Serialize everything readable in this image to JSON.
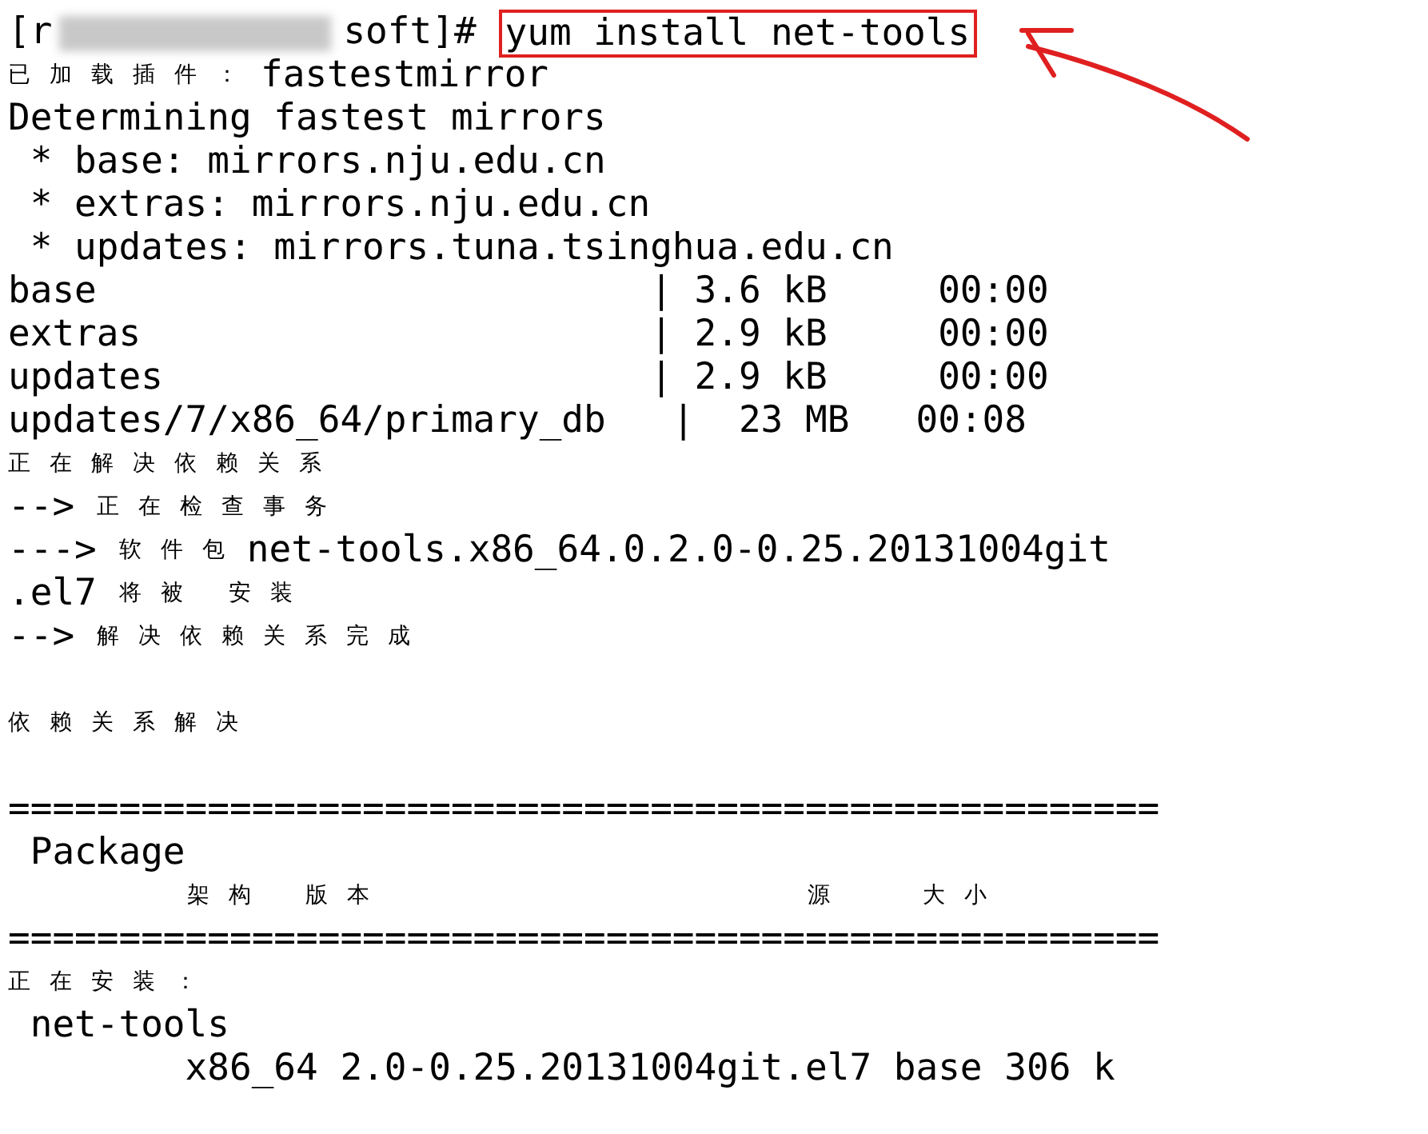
{
  "prompt": {
    "user_start": "[r",
    "redacted": true,
    "path": "soft]#",
    "command": "yum install net-tools",
    "highlighted": true,
    "arrow": true
  },
  "lines": [
    {
      "segs": [
        {
          "kind": "cjk",
          "text": "已加载插件："
        },
        {
          "kind": "mono",
          "text": "fastestmirror"
        }
      ]
    },
    {
      "segs": [
        {
          "kind": "mono",
          "text": "Determining fastest mirrors"
        }
      ]
    },
    {
      "segs": [
        {
          "kind": "mono",
          "text": " * base: mirrors.nju.edu.cn"
        }
      ]
    },
    {
      "segs": [
        {
          "kind": "mono",
          "text": " * extras: mirrors.nju.edu.cn"
        }
      ]
    },
    {
      "segs": [
        {
          "kind": "mono",
          "text": " * updates: mirrors.tuna.tsinghua.edu.cn"
        }
      ]
    },
    {
      "segs": [
        {
          "kind": "mono",
          "text": "base                         | 3.6 kB     00:00"
        }
      ]
    },
    {
      "segs": [
        {
          "kind": "mono",
          "text": "extras                       | 2.9 kB     00:00"
        }
      ]
    },
    {
      "segs": [
        {
          "kind": "mono",
          "text": "updates                      | 2.9 kB     00:00"
        }
      ]
    },
    {
      "segs": [
        {
          "kind": "mono",
          "text": "updates/7/x86_64/primary_db   |  23 MB   00:08"
        }
      ]
    },
    {
      "segs": [
        {
          "kind": "cjk",
          "text": "正在解决依赖关系"
        }
      ]
    },
    {
      "segs": [
        {
          "kind": "mono",
          "text": "-->"
        },
        {
          "kind": "cjk",
          "text": "正在检查事务"
        }
      ]
    },
    {
      "segs": [
        {
          "kind": "mono",
          "text": "--->"
        },
        {
          "kind": "cjk",
          "text": "软件包"
        },
        {
          "kind": "mono",
          "text": "net-tools.x86_64.0.2.0-0.25.20131004git"
        }
      ]
    },
    {
      "segs": [
        {
          "kind": "mono",
          "text": ".el7"
        },
        {
          "kind": "cjk",
          "text": "将被 安装"
        }
      ]
    },
    {
      "segs": [
        {
          "kind": "mono",
          "text": "-->"
        },
        {
          "kind": "cjk",
          "text": "解决依赖关系完成"
        }
      ]
    },
    {
      "kind": "blank"
    },
    {
      "segs": [
        {
          "kind": "cjk",
          "text": "依赖关系解决"
        }
      ]
    },
    {
      "kind": "blank"
    },
    {
      "segs": [
        {
          "kind": "mono",
          "text": "===================================================="
        }
      ]
    },
    {
      "segs": [
        {
          "kind": "mono",
          "text": " Package"
        }
      ]
    },
    {
      "segs": [
        {
          "kind": "arch",
          "text": "架构"
        },
        {
          "kind": "version",
          "text": "版本"
        },
        {
          "kind": "repo",
          "text": "源"
        },
        {
          "kind": "size",
          "text": "大小"
        }
      ]
    },
    {
      "segs": [
        {
          "kind": "mono",
          "text": "===================================================="
        }
      ]
    },
    {
      "segs": [
        {
          "kind": "cjk",
          "text": "正在安装："
        }
      ]
    },
    {
      "segs": [
        {
          "kind": "mono",
          "text": " net-tools"
        }
      ]
    },
    {
      "segs": [
        {
          "kind": "mono",
          "text": "        x86_64 2.0-0.25.20131004git.el7 base 306 k"
        }
      ]
    }
  ]
}
